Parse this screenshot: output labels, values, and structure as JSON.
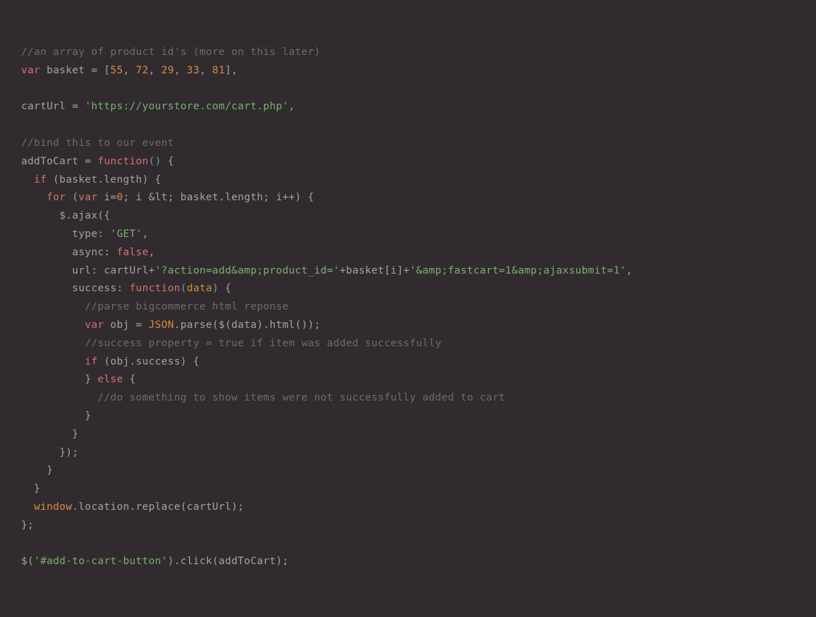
{
  "code": {
    "l1": {
      "comment": "//an array of product id's (more on this later)"
    },
    "l2": {
      "kw": "var",
      "name": " basket = [",
      "n1": "55",
      "c1": ", ",
      "n2": "72",
      "c2": ", ",
      "n3": "29",
      "c3": ", ",
      "n4": "33",
      "c4": ", ",
      "n5": "81",
      "end": "],"
    },
    "l3": "",
    "l4": {
      "name": "cartUrl = ",
      "str": "'https://yourstore.com/cart.php'",
      "end": ","
    },
    "l5": "",
    "l6": {
      "comment": "//bind this to our event"
    },
    "l7": {
      "name": "addToCart = ",
      "fn": "function",
      "paren": "()",
      "brace": " {"
    },
    "l8": {
      "pad": "  ",
      "if": "if",
      "rest": " (basket.length) {"
    },
    "l9": {
      "pad": "    ",
      "for": "for",
      "open": " (",
      "var": "var",
      "i": " i=",
      "zero": "0",
      "rest": "; i &lt; basket.length; i++) {"
    },
    "l10": {
      "pad": "      ",
      "text": "$.ajax({"
    },
    "l11": {
      "pad": "        ",
      "key": "type: ",
      "str": "'GET'",
      "end": ","
    },
    "l12": {
      "pad": "        ",
      "key": "async: ",
      "val": "false",
      "end": ","
    },
    "l13": {
      "pad": "        ",
      "key": "url: cartUrl+",
      "str1": "'?action=add&amp;product_id='",
      "mid": "+basket[i]+",
      "str2": "'&amp;fastcart=1&amp;ajaxsubmit=1'",
      "end": ","
    },
    "l14": {
      "pad": "        ",
      "key": "success: ",
      "fn": "function",
      "open": "(",
      "param": "data",
      "close": ")",
      "brace": " {"
    },
    "l15": {
      "pad": "          ",
      "comment": "//parse bigcommerce html reponse"
    },
    "l16": {
      "pad": "          ",
      "var": "var",
      "name": " obj = ",
      "json": "JSON",
      "rest": ".parse($(data).html());"
    },
    "l17": {
      "pad": "          ",
      "comment": "//success property = true if item was added successfully"
    },
    "l18": {
      "pad": "          ",
      "if": "if",
      "rest": " (obj.success) {"
    },
    "l19": {
      "pad": "          ",
      "brace": "} ",
      "else": "else",
      "rest": " {"
    },
    "l20": {
      "pad": "            ",
      "comment": "//do something to show items were not successfully added to cart"
    },
    "l21": {
      "pad": "          ",
      "brace": "}"
    },
    "l22": {
      "pad": "        ",
      "brace": "}"
    },
    "l23": {
      "pad": "      ",
      "brace": "});"
    },
    "l24": {
      "pad": "    ",
      "brace": "}"
    },
    "l25": {
      "pad": "  ",
      "brace": "}"
    },
    "l26": {
      "pad": "  ",
      "win": "window",
      "rest": ".location.replace(cartUrl);"
    },
    "l27": {
      "brace": "};"
    },
    "l28": "",
    "l29": {
      "pre": "$(",
      "str": "'#add-to-cart-button'",
      "rest": ").click(addToCart);"
    }
  }
}
